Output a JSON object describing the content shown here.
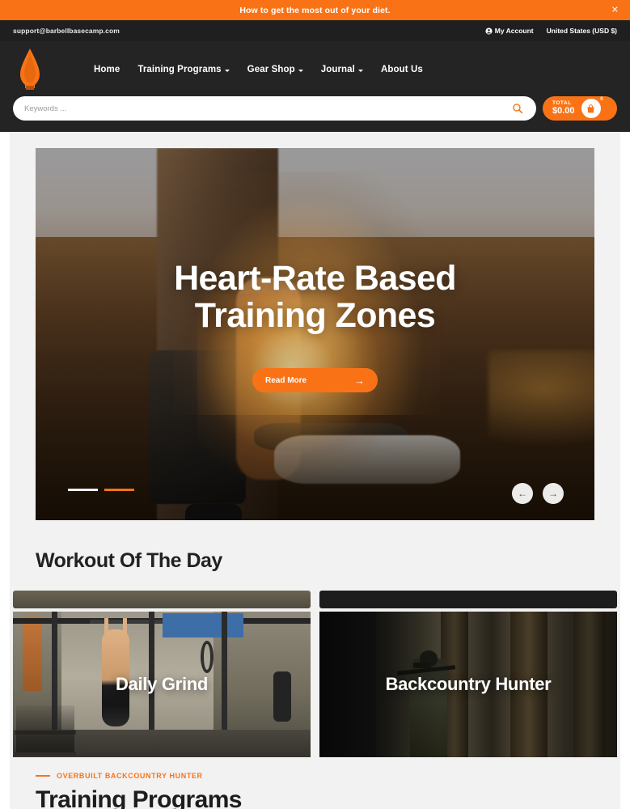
{
  "promo": {
    "text": "How to get the most out of your diet.",
    "close_icon": "close-icon",
    "bg_color": "#f97316"
  },
  "utility_bar": {
    "email": "support@barbellbasecamp.com",
    "account_label": "My Account",
    "account_icon": "user-circle-icon",
    "locale_label": "United States (USD $)"
  },
  "header": {
    "logo_icon": "arrowhead-logo",
    "nav": [
      {
        "label": "Home",
        "has_dropdown": false
      },
      {
        "label": "Training Programs",
        "has_dropdown": true
      },
      {
        "label": "Gear Shop",
        "has_dropdown": true
      },
      {
        "label": "Journal",
        "has_dropdown": true
      },
      {
        "label": "About Us",
        "has_dropdown": false
      }
    ],
    "search": {
      "placeholder": "Keywords ...",
      "value": "",
      "icon": "search-icon"
    },
    "cart": {
      "total_label": "TOTAL",
      "total_value": "$0.00",
      "count": "0",
      "icon": "shopping-bag-icon"
    }
  },
  "hero": {
    "title": "Heart-Rate Based Training Zones",
    "cta_label": "Read More",
    "cta_icon": "arrow-right-icon",
    "slides": [
      {
        "indicator": "active",
        "color": "#ffffff"
      },
      {
        "indicator": "inactive",
        "color": "#f97316"
      }
    ],
    "prev_icon": "arrow-left-icon",
    "next_icon": "arrow-right-icon"
  },
  "workout_of_the_day": {
    "heading": "Workout Of The Day",
    "cards": [
      {
        "title": "Daily Grind",
        "image": "gym-pullup-photo"
      },
      {
        "title": "Backcountry Hunter",
        "image": "forest-hunter-photo"
      }
    ]
  },
  "training_programs": {
    "eyebrow": "OVERBUILT BACKCOUNTRY HUNTER",
    "heading": "Training Programs"
  },
  "colors": {
    "accent": "#f97316",
    "header_bg": "#242424",
    "utility_bg": "#1f1f1f",
    "page_bg": "#f2f2f2",
    "text_dark": "#1d1d1d"
  }
}
